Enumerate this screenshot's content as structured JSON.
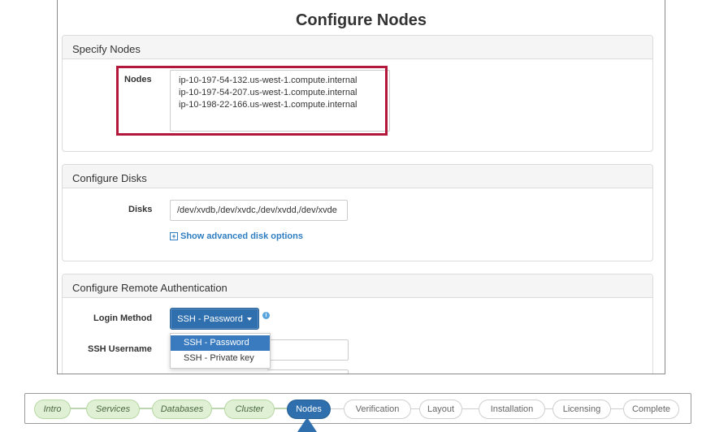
{
  "page": {
    "title": "Configure Nodes"
  },
  "specify_nodes": {
    "heading": "Specify Nodes",
    "nodes_label": "Nodes",
    "nodes": [
      "ip-10-197-54-132.us-west-1.compute.internal",
      "ip-10-197-54-207.us-west-1.compute.internal",
      "ip-10-198-22-166.us-west-1.compute.internal"
    ],
    "highlight_color": "#b5173b"
  },
  "configure_disks": {
    "heading": "Configure Disks",
    "disks_label": "Disks",
    "disks_value": "/dev/xvdb,/dev/xvdc,/dev/xvdd,/dev/xvde",
    "advanced_link": "Show advanced disk options",
    "advanced_icon": "plus-square-icon"
  },
  "remote_auth": {
    "heading": "Configure Remote Authentication",
    "login_method_label": "Login Method",
    "login_method_selected": "SSH - Password",
    "info_icon": "info-icon",
    "login_options": [
      "SSH - Password",
      "SSH - Private key"
    ],
    "ssh_username_label": "SSH Username"
  },
  "wizard": {
    "steps": [
      {
        "label": "Intro",
        "state": "done"
      },
      {
        "label": "Services",
        "state": "done"
      },
      {
        "label": "Databases",
        "state": "done"
      },
      {
        "label": "Cluster",
        "state": "done"
      },
      {
        "label": "Nodes",
        "state": "active"
      },
      {
        "label": "Verification",
        "state": "todo"
      },
      {
        "label": "Layout",
        "state": "todo"
      },
      {
        "label": "Installation",
        "state": "todo"
      },
      {
        "label": "Licensing",
        "state": "todo"
      },
      {
        "label": "Complete",
        "state": "todo"
      }
    ]
  },
  "colors": {
    "primary": "#2f6fae",
    "done_step_bg": "#dff0d4",
    "link": "#2f7ec1"
  }
}
